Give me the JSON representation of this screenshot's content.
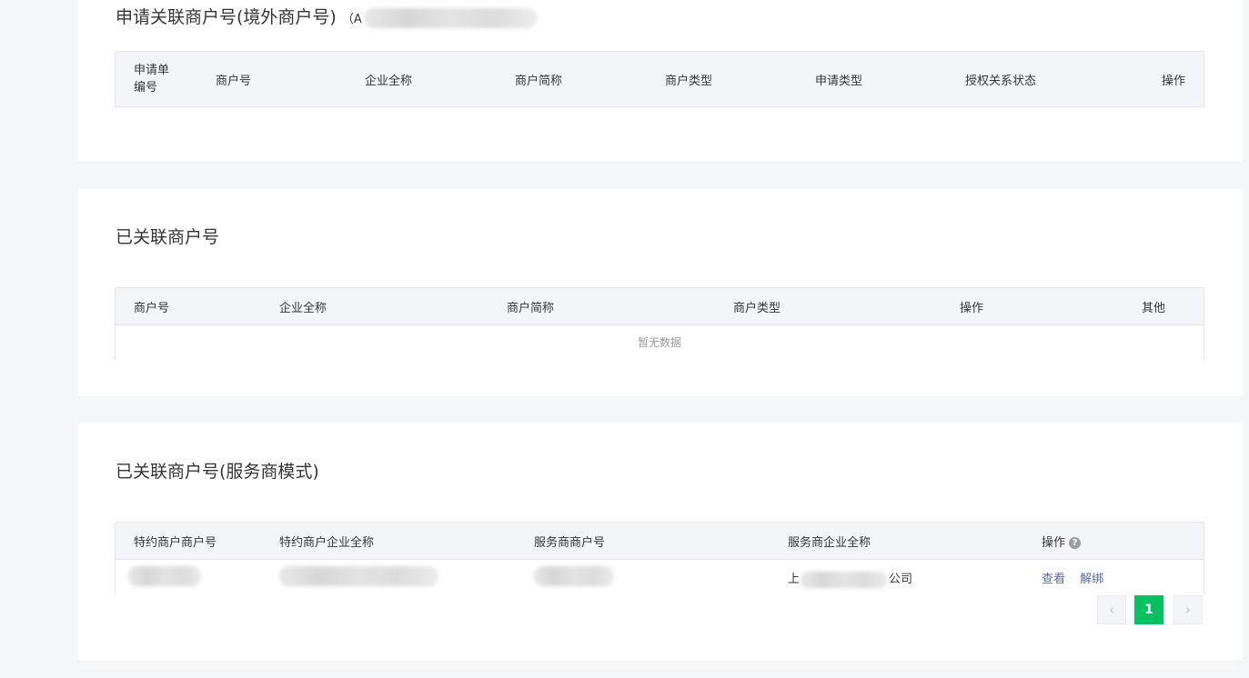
{
  "section1": {
    "title": "申请关联商户号(境外商户号)",
    "note": "（A",
    "columns": [
      "申请单编号",
      "商户号",
      "企业全称",
      "商户简称",
      "商户类型",
      "申请类型",
      "授权关系状态",
      "操作"
    ],
    "col_first_line1": "申请单",
    "col_first_line2": "编号"
  },
  "section2": {
    "title": "已关联商户号",
    "columns": [
      "商户号",
      "企业全称",
      "商户简称",
      "商户类型",
      "操作",
      "其他"
    ],
    "empty_text": "暂无数据"
  },
  "section3": {
    "title": "已关联商户号(服务商模式)",
    "columns": [
      "特约商户商户号",
      "特约商户企业全称",
      "服务商商户号",
      "服务商企业全称",
      "操作"
    ],
    "row": {
      "provider_name_prefix": "上",
      "provider_name_suffix": "公司",
      "actions": [
        "查看",
        "解绑"
      ]
    },
    "help_icon": "?",
    "pagination": {
      "prev": "‹",
      "current": "1",
      "next": "›"
    }
  },
  "colors": {
    "accent": "#07c160",
    "link": "#576b95",
    "header_bg": "#f4f5f9"
  }
}
